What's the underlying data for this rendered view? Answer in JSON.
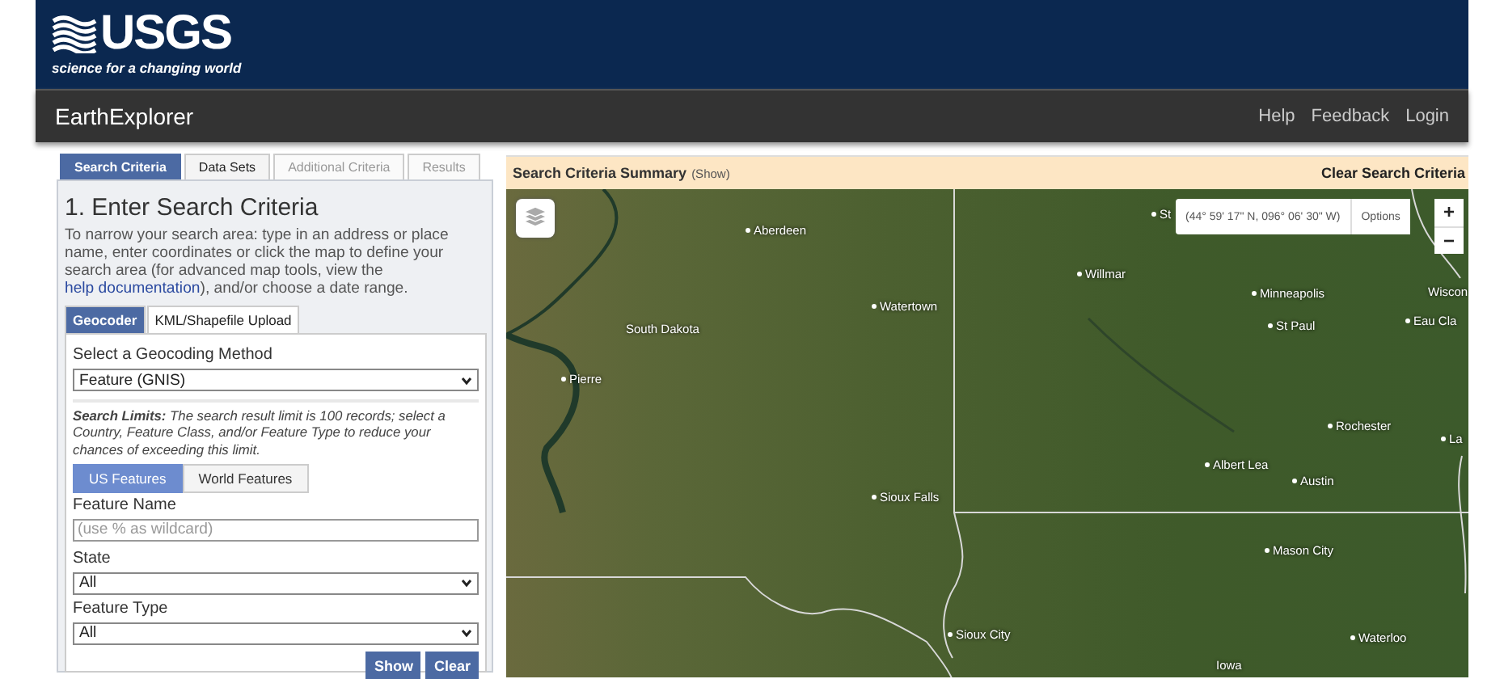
{
  "header": {
    "logo_text": "USGS",
    "tagline": "science for a changing world"
  },
  "navbar": {
    "title": "EarthExplorer",
    "links": [
      "Help",
      "Feedback",
      "Login"
    ]
  },
  "tabs": [
    {
      "label": "Search Criteria",
      "selected": true,
      "disabled": false
    },
    {
      "label": "Data Sets",
      "selected": false,
      "disabled": false
    },
    {
      "label": "Additional Criteria",
      "selected": false,
      "disabled": true
    },
    {
      "label": "Results",
      "selected": false,
      "disabled": true
    }
  ],
  "search_panel": {
    "heading": "1. Enter Search Criteria",
    "intro_before": "To narrow your search area: type in an address or place name, enter coordinates or click the map to define your search area (for advanced map tools, view the ",
    "intro_link": "help documentation",
    "intro_after": "), and/or choose a date range.",
    "subtabs": [
      {
        "label": "Geocoder",
        "selected": true
      },
      {
        "label": "KML/Shapefile Upload",
        "selected": false
      }
    ],
    "method_label": "Select a Geocoding Method",
    "method_value": "Feature (GNIS)",
    "limits_note": "**Search Limits:** The search result limit is 100 records; select a Country, Feature Class, and/or Feature Type to reduce your chances of exceeding this limit.",
    "feature_sets": [
      {
        "label": "US Features",
        "selected": true
      },
      {
        "label": "World Features",
        "selected": false
      }
    ],
    "feature_name": {
      "label": "Feature Name",
      "placeholder": "(use % as wildcard)"
    },
    "state": {
      "label": "State",
      "value": "All"
    },
    "feature_type": {
      "label": "Feature Type",
      "value": "All"
    },
    "buttons": [
      "Show",
      "Clear"
    ]
  },
  "map": {
    "summary_title": "Search Criteria Summary",
    "summary_toggle": "(Show)",
    "clear_link": "Clear Search Criteria",
    "coordinates": "(44° 59' 17\" N, 096° 06' 30\" W)",
    "options": "Options",
    "zoom_in": "+",
    "zoom_out": "−",
    "places": [
      {
        "name": "Aberdeen",
        "kind": "city"
      },
      {
        "name": "Watertown",
        "kind": "city"
      },
      {
        "name": "South Dakota",
        "kind": "region"
      },
      {
        "name": "Pierre",
        "kind": "city"
      },
      {
        "name": "Willmar",
        "kind": "city"
      },
      {
        "name": "St",
        "kind": "city"
      },
      {
        "name": "Minneapolis",
        "kind": "city"
      },
      {
        "name": "St Paul",
        "kind": "city"
      },
      {
        "name": "Wiscon",
        "kind": "region"
      },
      {
        "name": "Eau Cla",
        "kind": "city"
      },
      {
        "name": "Rochester",
        "kind": "city"
      },
      {
        "name": "La",
        "kind": "city"
      },
      {
        "name": "Albert Lea",
        "kind": "city"
      },
      {
        "name": "Austin",
        "kind": "city"
      },
      {
        "name": "Sioux Falls",
        "kind": "city"
      },
      {
        "name": "Mason City",
        "kind": "city"
      },
      {
        "name": "Sioux City",
        "kind": "city"
      },
      {
        "name": "Waterloo",
        "kind": "city"
      },
      {
        "name": "Iowa",
        "kind": "region"
      }
    ]
  }
}
